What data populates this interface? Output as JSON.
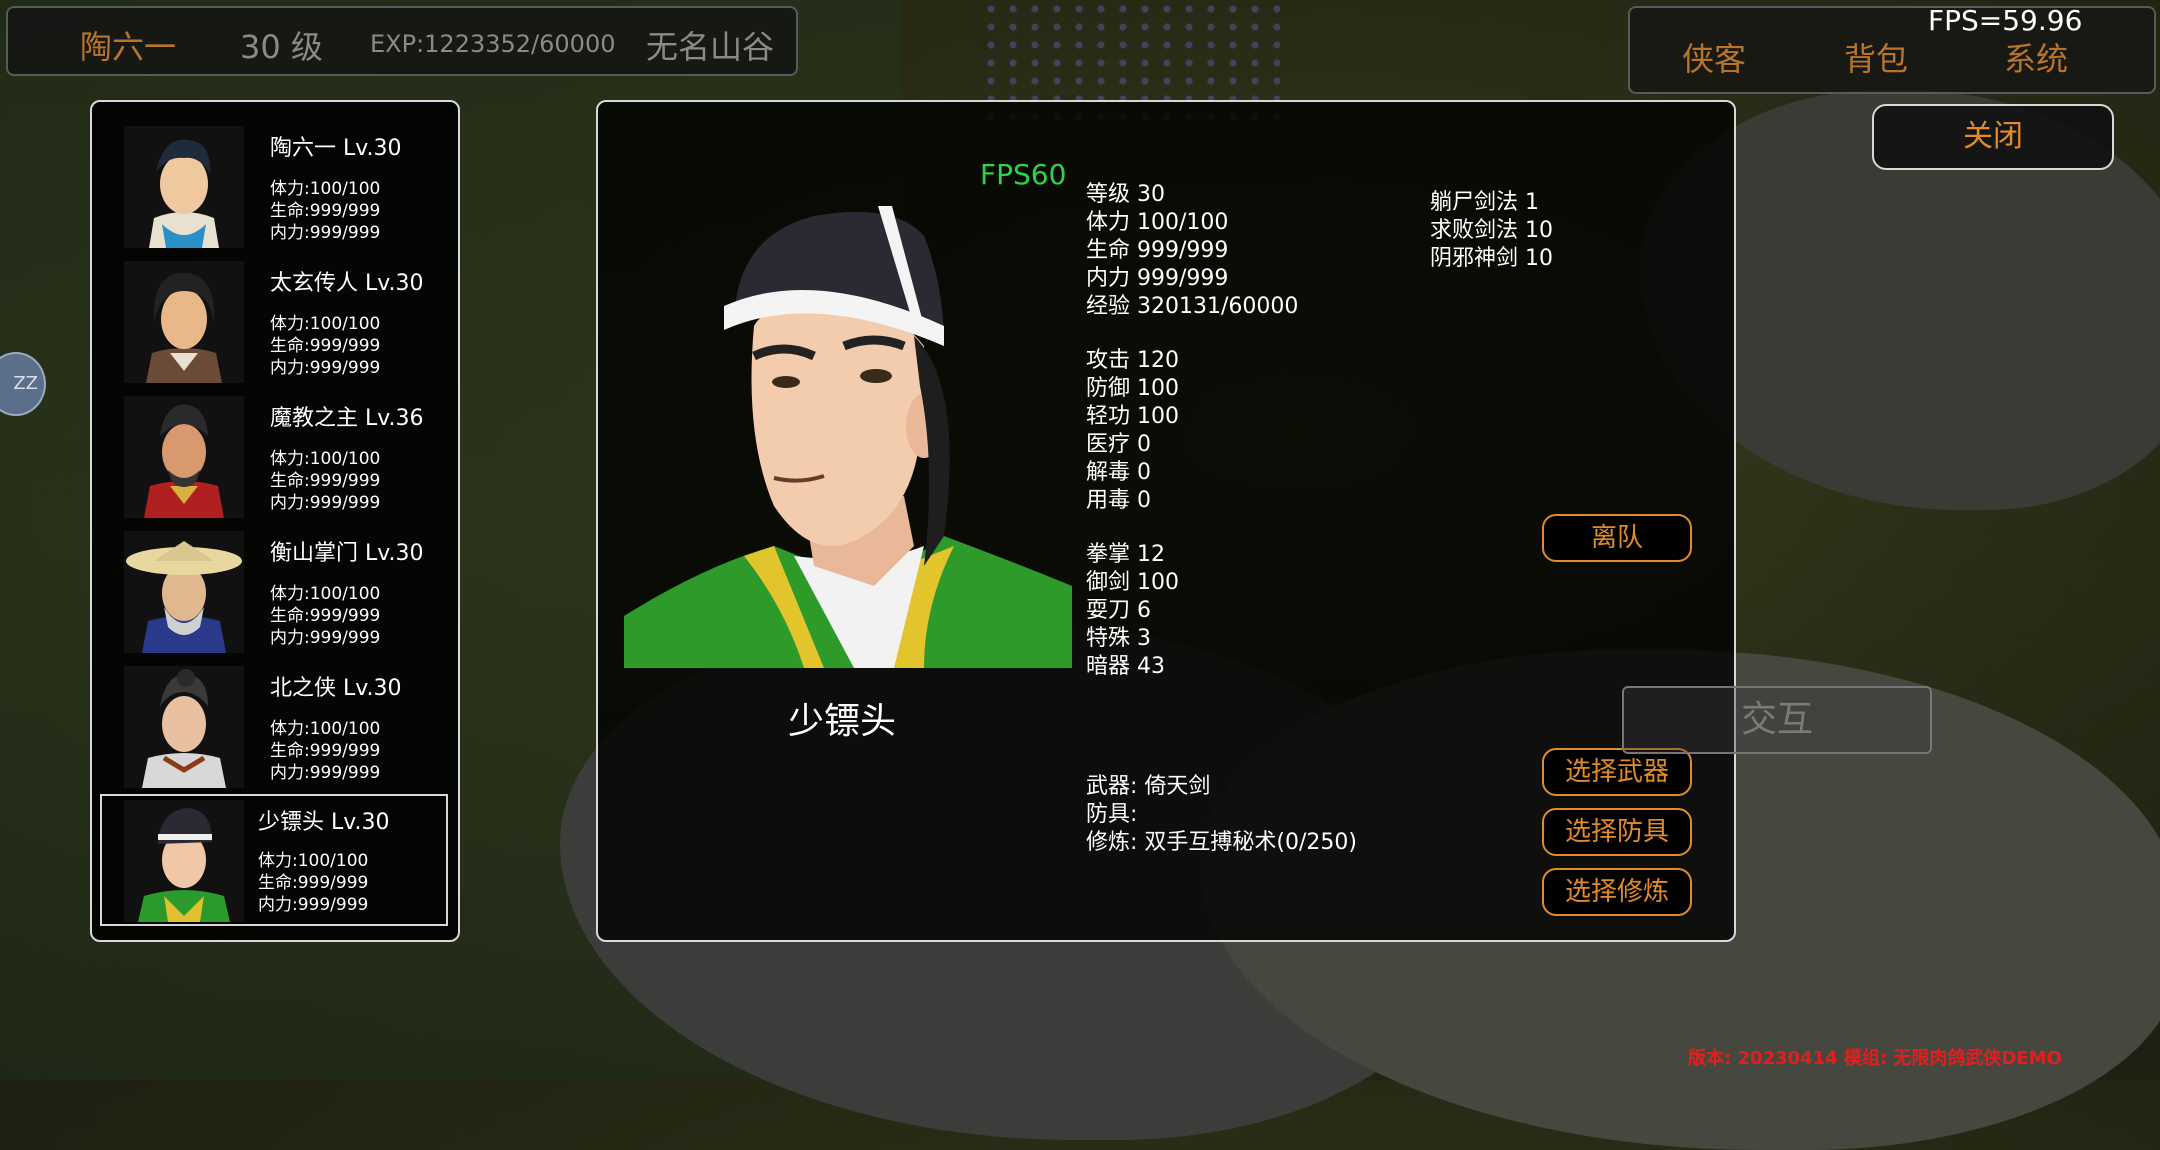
{
  "topbar": {
    "name": "陶六一",
    "level": "30 级",
    "exp": "EXP:1223352/60000",
    "location": "无名山谷"
  },
  "menu": {
    "items": [
      "侠客",
      "背包",
      "系统"
    ],
    "fps": "FPS=59.96"
  },
  "close_label": "关闭",
  "edge_button": "ZZ",
  "party": [
    {
      "name": "陶六一 Lv.30",
      "stamina": "体力:100/100",
      "hp": "生命:999/999",
      "mp": "内力:999/999"
    },
    {
      "name": "太玄传人 Lv.30",
      "stamina": "体力:100/100",
      "hp": "生命:999/999",
      "mp": "内力:999/999"
    },
    {
      "name": "魔教之主 Lv.36",
      "stamina": "体力:100/100",
      "hp": "生命:999/999",
      "mp": "内力:999/999"
    },
    {
      "name": "衡山掌门 Lv.30",
      "stamina": "体力:100/100",
      "hp": "生命:999/999",
      "mp": "内力:999/999"
    },
    {
      "name": "北之侠 Lv.30",
      "stamina": "体力:100/100",
      "hp": "生命:999/999",
      "mp": "内力:999/999"
    },
    {
      "name": "少镖头 Lv.30",
      "stamina": "体力:100/100",
      "hp": "生命:999/999",
      "mp": "内力:999/999"
    }
  ],
  "detail": {
    "fps": "FPS60",
    "name": "少镖头",
    "basic": [
      "等级 30",
      "体力 100/100",
      "生命 999/999",
      "内力 999/999",
      "经验 320131/60000"
    ],
    "combat": [
      "攻击 120",
      "防御 100",
      "轻功 100",
      "医疗 0",
      "解毒 0",
      "用毒 0"
    ],
    "skills": [
      "拳掌 12",
      "御剑 100",
      "耍刀 6",
      "特殊 3",
      "暗器 43"
    ],
    "arts": [
      "躺尸剑法 1",
      "求败剑法 10",
      "阴邪神剑 10"
    ],
    "equip": {
      "weapon": "武器: 倚天剑",
      "armor": "防具:",
      "training": "修炼: 双手互搏秘术(0/250)"
    }
  },
  "buttons": {
    "leave": "离队",
    "choose_weapon": "选择武器",
    "choose_armor": "选择防具",
    "choose_training": "选择修炼",
    "interact": "交互"
  },
  "version": "版本: 20230414 模组: 无限肉鸽武侠DEMO",
  "colors": {
    "accent": "#e08c2c",
    "fps_green": "#2fd34a",
    "version_red": "#e02020"
  }
}
